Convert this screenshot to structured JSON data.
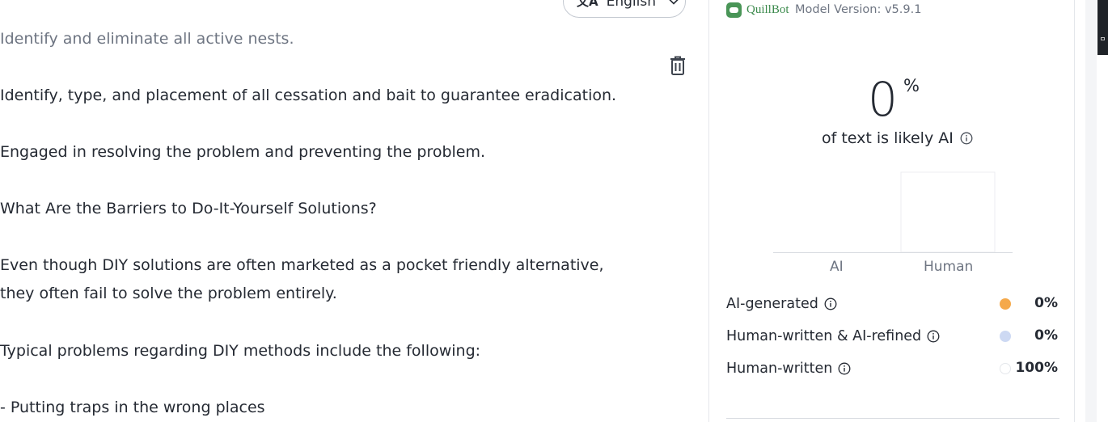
{
  "editor": {
    "language_label": "English",
    "paragraphs": [
      "Identify and eliminate all active nests.",
      "Identify, type, and placement of all cessation and bait to guarantee eradication.",
      "Engaged in resolving the problem and preventing the problem.",
      "What Are the Barriers to Do-It-Yourself Solutions?",
      "Even though DIY solutions are often marketed as a pocket friendly alternative,",
      "they often fail to solve the problem entirely.",
      "Typical problems regarding DIY methods include the following:",
      "- Putting traps in the wrong places"
    ]
  },
  "detector": {
    "brand": "QuillBot",
    "model_version": "Model Version: v5.9.1",
    "score_value": "0",
    "score_unit": "%",
    "score_caption": "of text is likely AI",
    "legend": [
      {
        "label": "AI-generated",
        "percent": "0%",
        "color": "#f5a94b"
      },
      {
        "label": "Human-written & AI-refined",
        "percent": "0%",
        "color": "#cdd9f3"
      },
      {
        "label": "Human-written",
        "percent": "100%",
        "color": "#ffffff"
      }
    ]
  },
  "chart_data": {
    "type": "bar",
    "categories": [
      "AI",
      "Human"
    ],
    "values": [
      0,
      100
    ],
    "ylim": [
      0,
      100
    ],
    "grid": false,
    "xlabel": "",
    "ylabel": ""
  }
}
